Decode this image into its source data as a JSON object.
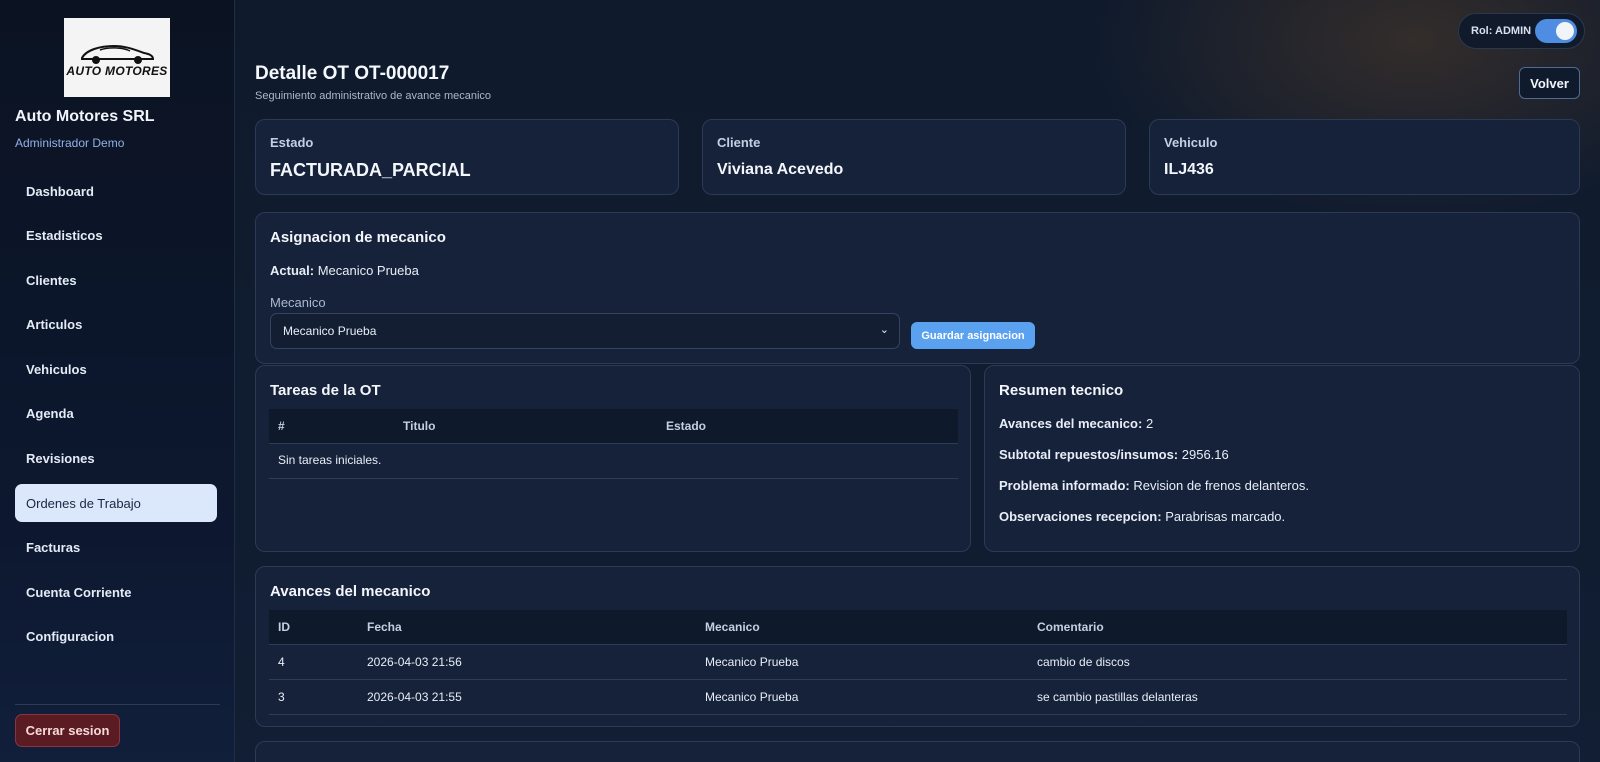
{
  "sidebar": {
    "logo_text": "AUTO MOTORES",
    "company": "Auto Motores SRL",
    "user": "Administrador Demo",
    "items": [
      {
        "label": "Dashboard"
      },
      {
        "label": "Estadisticos"
      },
      {
        "label": "Clientes"
      },
      {
        "label": "Articulos"
      },
      {
        "label": "Vehiculos"
      },
      {
        "label": "Agenda"
      },
      {
        "label": "Revisiones"
      },
      {
        "label": "Ordenes de Trabajo",
        "active": true
      },
      {
        "label": "Facturas"
      },
      {
        "label": "Cuenta Corriente"
      },
      {
        "label": "Configuracion"
      }
    ],
    "logout_label": "Cerrar sesion"
  },
  "header": {
    "role_label": "Rol: ADMIN",
    "role_toggle_on": true,
    "title": "Detalle OT OT-000017",
    "subtitle": "Seguimiento administrativo de avance mecanico",
    "back_label": "Volver"
  },
  "summary": {
    "estado": {
      "label": "Estado",
      "value": "FACTURADA_PARCIAL"
    },
    "cliente": {
      "label": "Cliente",
      "value": "Viviana Acevedo"
    },
    "vehiculo": {
      "label": "Vehiculo",
      "value": "ILJ436"
    }
  },
  "assignment": {
    "title": "Asignacion de mecanico",
    "current_label": "Actual:",
    "current_value": "Mecanico Prueba",
    "field_label": "Mecanico",
    "selected": "Mecanico Prueba",
    "save_label": "Guardar asignacion"
  },
  "tasks": {
    "title": "Tareas de la OT",
    "columns": [
      "#",
      "Titulo",
      "Estado"
    ],
    "empty": "Sin tareas iniciales."
  },
  "tech_summary": {
    "title": "Resumen tecnico",
    "avances": {
      "label": "Avances del mecanico:",
      "value": "2"
    },
    "subtotal": {
      "label": "Subtotal repuestos/insumos:",
      "value": "2956.16"
    },
    "problema": {
      "label": "Problema informado:",
      "value": "Revision de frenos delanteros."
    },
    "observaciones": {
      "label": "Observaciones recepcion:",
      "value": "Parabrisas marcado."
    }
  },
  "progress": {
    "title": "Avances del mecanico",
    "columns": [
      "ID",
      "Fecha",
      "Mecanico",
      "Comentario"
    ],
    "rows": [
      {
        "id": "4",
        "fecha": "2026-04-03 21:56",
        "mecanico": "Mecanico Prueba",
        "comentario": "cambio de discos"
      },
      {
        "id": "3",
        "fecha": "2026-04-03 21:55",
        "mecanico": "Mecanico Prueba",
        "comentario": "se cambio pastillas delanteras"
      }
    ]
  },
  "colors": {
    "accent": "#5aa2ef",
    "sidebar_active_bg": "#dbe7fb",
    "logout_bg": "#5a1b23",
    "card_bg": "#16223a"
  }
}
